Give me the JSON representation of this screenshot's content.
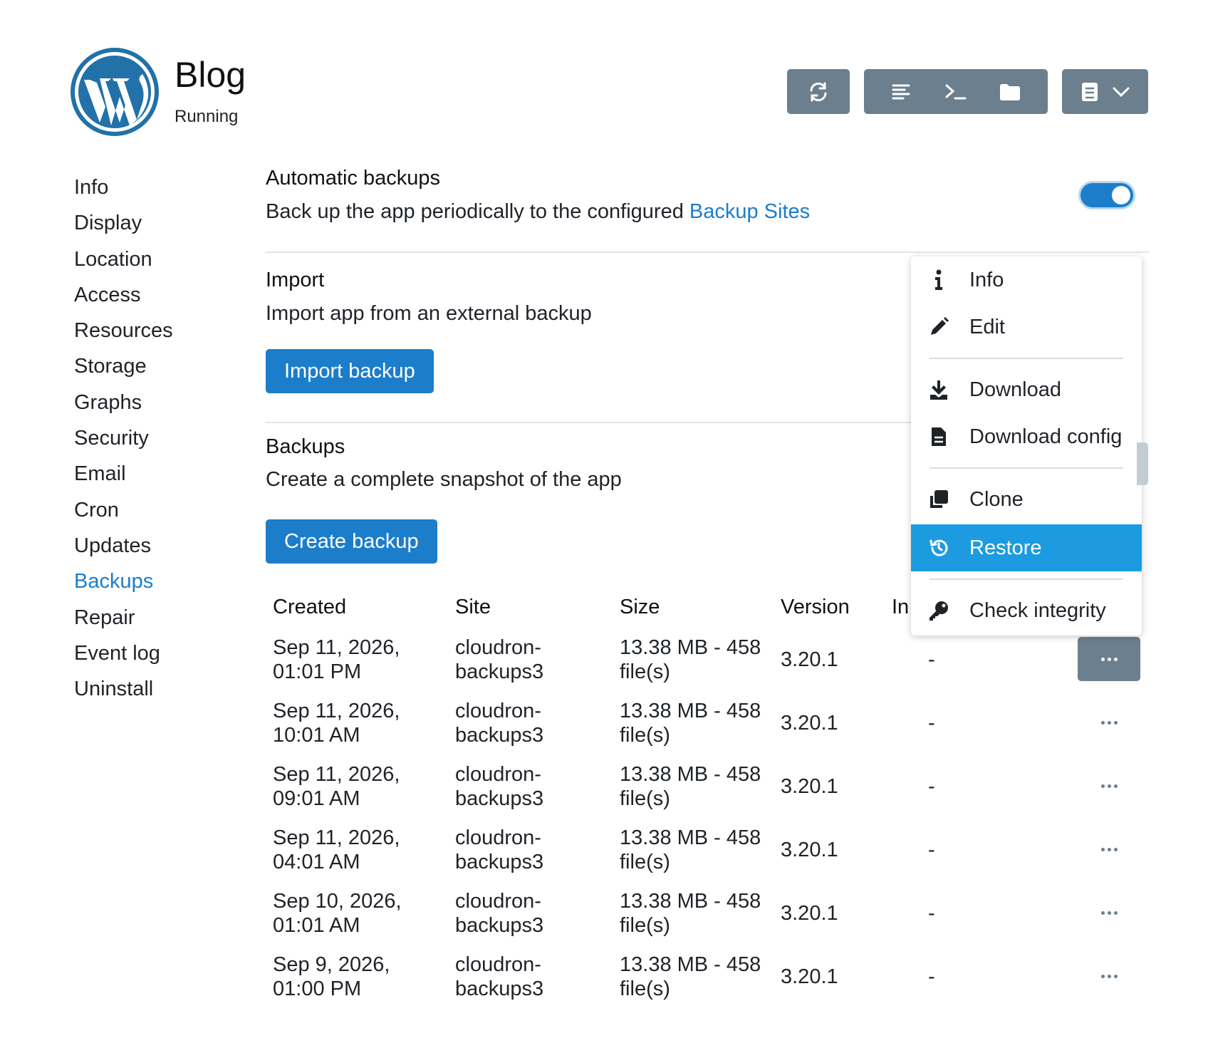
{
  "app": {
    "title": "Blog",
    "status": "Running",
    "logo": "wordpress-logo"
  },
  "toolbar": {
    "icons": [
      "refresh-icon",
      "logs-icon",
      "terminal-icon",
      "folder-icon",
      "docs-icon",
      "chevron-down-icon"
    ]
  },
  "sidebar": {
    "items": [
      "Info",
      "Display",
      "Location",
      "Access",
      "Resources",
      "Storage",
      "Graphs",
      "Security",
      "Email",
      "Cron",
      "Updates",
      "Backups",
      "Repair",
      "Event log",
      "Uninstall"
    ],
    "active": "Backups"
  },
  "auto_backups": {
    "title": "Automatic backups",
    "desc": "Back up the app periodically to the configured ",
    "link": "Backup Sites",
    "enabled": true
  },
  "import": {
    "title": "Import",
    "desc": "Import app from an external backup",
    "button": "Import backup"
  },
  "backups": {
    "title": "Backups",
    "desc": "Create a complete snapshot of the app",
    "button": "Create backup",
    "columns": [
      "Created",
      "Site",
      "Size",
      "Version",
      "In"
    ],
    "rows": [
      {
        "created1": "Sep 11, 2026,",
        "created2": "01:01 PM",
        "site1": "cloudron-",
        "site2": "backups3",
        "size1": "13.38 MB - 458",
        "size2": "file(s)",
        "version": "3.20.1",
        "info": "-"
      },
      {
        "created1": "Sep 11, 2026,",
        "created2": "10:01 AM",
        "site1": "cloudron-",
        "site2": "backups3",
        "size1": "13.38 MB - 458",
        "size2": "file(s)",
        "version": "3.20.1",
        "info": "-"
      },
      {
        "created1": "Sep 11, 2026,",
        "created2": "09:01 AM",
        "site1": "cloudron-",
        "site2": "backups3",
        "size1": "13.38 MB - 458",
        "size2": "file(s)",
        "version": "3.20.1",
        "info": "-"
      },
      {
        "created1": "Sep 11, 2026,",
        "created2": "04:01 AM",
        "site1": "cloudron-",
        "site2": "backups3",
        "size1": "13.38 MB - 458",
        "size2": "file(s)",
        "version": "3.20.1",
        "info": "-"
      },
      {
        "created1": "Sep 10, 2026,",
        "created2": "01:01 AM",
        "site1": "cloudron-",
        "site2": "backups3",
        "size1": "13.38 MB - 458",
        "size2": "file(s)",
        "version": "3.20.1",
        "info": "-"
      },
      {
        "created1": "Sep 9, 2026,",
        "created2": "01:00 PM",
        "site1": "cloudron-",
        "site2": "backups3",
        "size1": "13.38 MB - 458",
        "size2": "file(s)",
        "version": "3.20.1",
        "info": "-"
      }
    ]
  },
  "menu": {
    "items": [
      {
        "label": "Info",
        "icon": "info-icon"
      },
      {
        "label": "Edit",
        "icon": "pencil-icon"
      },
      {
        "label": "Download",
        "icon": "download-icon"
      },
      {
        "label": "Download config",
        "icon": "file-icon"
      },
      {
        "label": "Clone",
        "icon": "clone-icon"
      },
      {
        "label": "Restore",
        "icon": "restore-icon"
      },
      {
        "label": "Check integrity",
        "icon": "key-icon"
      }
    ],
    "selected": "Restore"
  },
  "colors": {
    "accent": "#1c7dcb",
    "toolbar": "#6b7f8e",
    "menu_highlight": "#1c9be0"
  }
}
